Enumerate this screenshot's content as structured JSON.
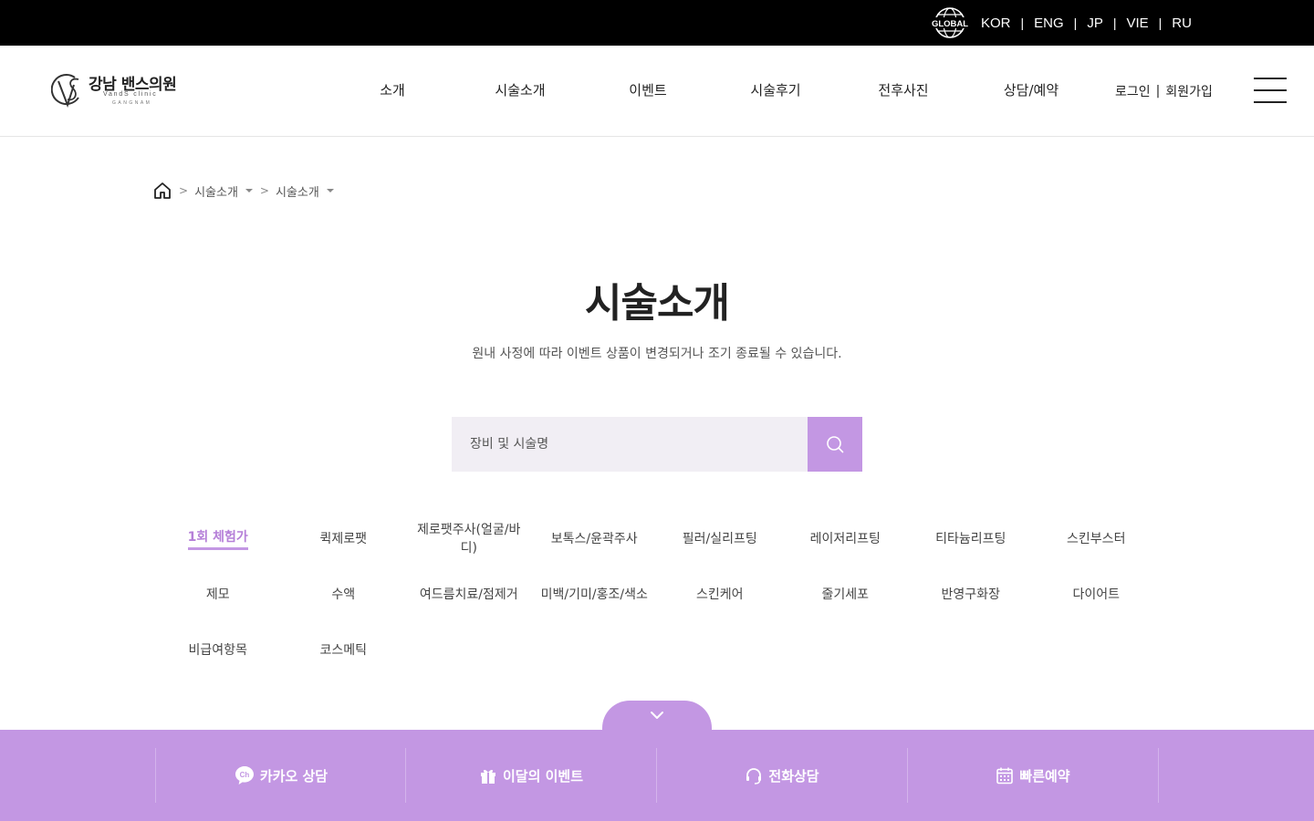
{
  "topbar": {
    "languages": [
      "KOR",
      "ENG",
      "JP",
      "VIE",
      "RU"
    ],
    "separator": "|",
    "global_label": "GLOBAL"
  },
  "header": {
    "logo_title": "강남 밴스의원",
    "logo_subtitle": "VandS clinic",
    "logo_location": "GANGNAM",
    "nav": [
      "소개",
      "시술소개",
      "이벤트",
      "시술후기",
      "전후사진",
      "상담/예약"
    ],
    "login": "로그인",
    "auth_separator": "|",
    "signup": "회원가입"
  },
  "breadcrumb": {
    "level1": "시술소개",
    "level2": "시술소개"
  },
  "main": {
    "title": "시술소개",
    "description": "원내 사정에 따라 이벤트 상품이 변경되거나 조기 종료될 수 있습니다.",
    "search_placeholder": "장비 및 시술명"
  },
  "categories": [
    "1회 체험가",
    "퀵제로팻",
    "제로팻주사(얼굴/바디)",
    "보톡스/윤곽주사",
    "필러/실리프팅",
    "레이저리프팅",
    "티타늄리프팅",
    "스킨부스터",
    "제모",
    "수액",
    "여드름치료/점제거",
    "미백/기미/홍조/색소",
    "스킨케어",
    "줄기세포",
    "반영구화장",
    "다이어트",
    "비급여항목",
    "코스메틱"
  ],
  "active_category": "1회 체험가",
  "bottom_bar": {
    "kakao": "카카오 상담",
    "event": "이달의 이벤트",
    "phone": "전화상담",
    "reserve": "빠른예약",
    "kakao_badge": "Ch"
  },
  "colors": {
    "accent": "#c397e3",
    "accent_text": "#b57fd8",
    "search_bg": "#f1eef4",
    "topbar_bg": "#000000"
  }
}
